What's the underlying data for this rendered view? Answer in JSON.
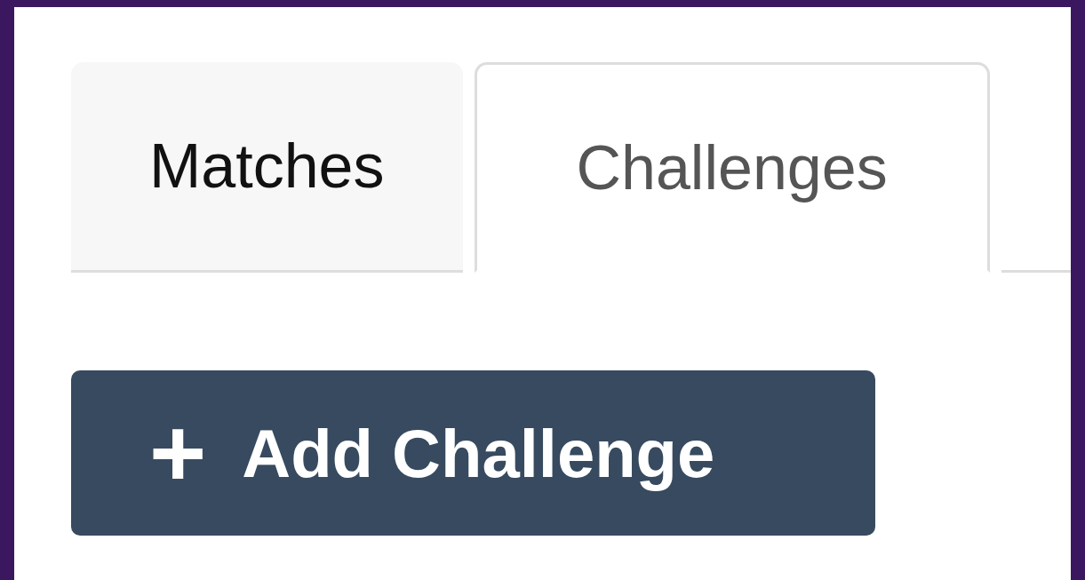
{
  "tabs": [
    {
      "label": "Matches",
      "selected": false
    },
    {
      "label": "Challenges",
      "selected": true
    }
  ],
  "add_button": {
    "icon": "+",
    "label": "Add Challenge"
  }
}
